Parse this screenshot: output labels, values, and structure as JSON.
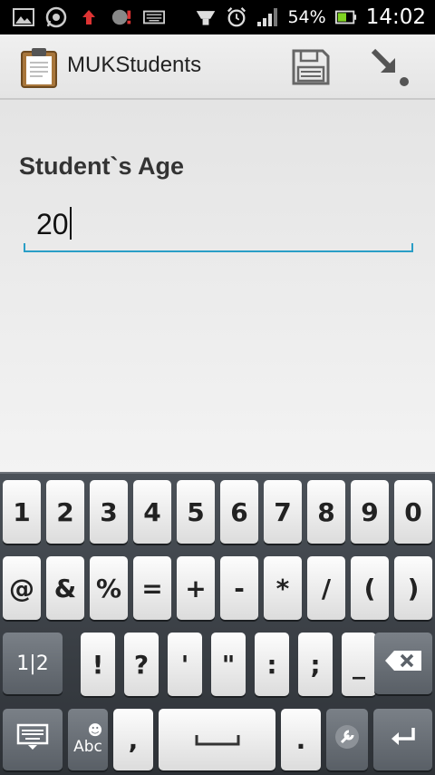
{
  "status_bar": {
    "left_icons": [
      "gallery-icon",
      "whatsapp-icon",
      "upload-icon",
      "messenger-icon",
      "keyboard-icon"
    ],
    "battery_percent": "54%",
    "time": "14:02",
    "right_icons": [
      "vibrate-icon",
      "alarm-icon",
      "signal-icon",
      "battery-icon"
    ]
  },
  "action_bar": {
    "title": "MUKStudents",
    "app_icon": "clipboard-icon",
    "actions": [
      "save-icon",
      "import-icon"
    ]
  },
  "form": {
    "label": "Student`s Age",
    "age_value": "20"
  },
  "keyboard": {
    "row1": [
      "1",
      "2",
      "3",
      "4",
      "5",
      "6",
      "7",
      "8",
      "9",
      "0"
    ],
    "row2": [
      "@",
      "&",
      "%",
      "=",
      "+",
      "-",
      "*",
      "/",
      "(",
      ")"
    ],
    "row3": [
      "1|2",
      "!",
      "?",
      "'",
      "\"",
      ":",
      ";",
      "_"
    ],
    "row4": {
      "settings": "keyboard-settings-icon",
      "abc": "Abc",
      "comma": ",",
      "space": "space-icon",
      "period": ".",
      "tools": "wrench-icon",
      "enter": "enter-icon"
    },
    "delete": "backspace-icon",
    "accent_color": "#2a9ec6"
  }
}
